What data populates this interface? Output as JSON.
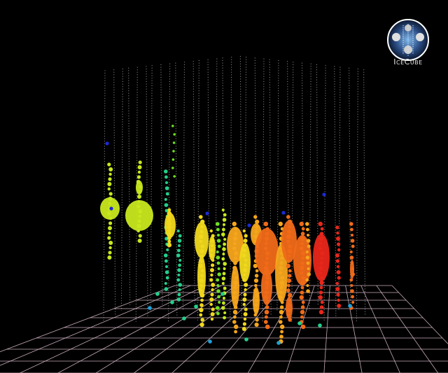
{
  "logo": {
    "text": "IceCube",
    "icon": "icecube-observatory-logo"
  },
  "colors": {
    "background": "#000000",
    "grid": "#e8c8d8",
    "sensor_dot": "#bdbdbd",
    "hit_scale": [
      "#1a2bd6",
      "#1fa0d8",
      "#22d08a",
      "#6fe022",
      "#c8e81e",
      "#f0d81c",
      "#f5a51c",
      "#f06a18",
      "#e8261a"
    ]
  }
}
